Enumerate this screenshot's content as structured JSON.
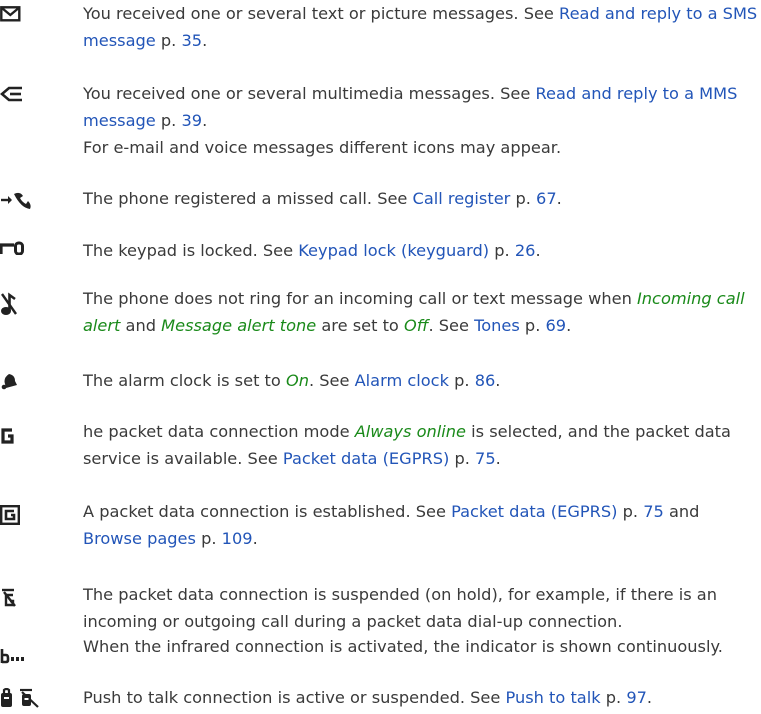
{
  "colors": {
    "text": "#3a3a3a",
    "link": "#2255b8",
    "emphasis": "#1a8a1a"
  },
  "entries": [
    {
      "icon": "envelope-icon",
      "parts": [
        {
          "t": "You received one or several text or picture messages. See "
        },
        {
          "link": "Read and reply to a SMS message"
        },
        {
          "t": " p. "
        },
        {
          "link": "35"
        },
        {
          "t": "."
        }
      ]
    },
    {
      "icon": "mms-message-icon",
      "parts": [
        {
          "t": "You received one or several multimedia messages. See "
        },
        {
          "link": "Read and reply to a MMS message"
        },
        {
          "t": " p. "
        },
        {
          "link": "39"
        },
        {
          "t": "."
        }
      ],
      "extra": "For e-mail and voice messages different icons may appear."
    },
    {
      "icon": "missed-call-icon",
      "parts": [
        {
          "t": "The phone registered a missed call. See "
        },
        {
          "link": "Call register"
        },
        {
          "t": " p. "
        },
        {
          "link": "67"
        },
        {
          "t": "."
        }
      ]
    },
    {
      "icon": "keypad-lock-icon",
      "parts": [
        {
          "t": "The keypad is locked. See "
        },
        {
          "link": "Keypad lock (keyguard)"
        },
        {
          "t": " p. "
        },
        {
          "link": "26"
        },
        {
          "t": "."
        }
      ]
    },
    {
      "icon": "silent-mode-icon",
      "parts": [
        {
          "t": "The phone does not ring for an incoming call or text message when "
        },
        {
          "em": "Incoming call alert"
        },
        {
          "t": " and "
        },
        {
          "em": "Message alert tone"
        },
        {
          "t": " are set to "
        },
        {
          "em": "Off"
        },
        {
          "t": ". See "
        },
        {
          "link": "Tones"
        },
        {
          "t": " p. "
        },
        {
          "link": "69"
        },
        {
          "t": "."
        }
      ]
    },
    {
      "icon": "alarm-bell-icon",
      "parts": [
        {
          "t": "The alarm clock is set to "
        },
        {
          "em": "On"
        },
        {
          "t": ". See "
        },
        {
          "link": "Alarm clock"
        },
        {
          "t": " p. "
        },
        {
          "link": "86"
        },
        {
          "t": "."
        }
      ]
    },
    {
      "icon": "packet-data-available-icon",
      "parts": [
        {
          "t": "he packet data connection mode "
        },
        {
          "em": "Always online"
        },
        {
          "t": " is selected, and the packet data service is available. See "
        },
        {
          "link": "Packet data (EGPRS)"
        },
        {
          "t": " p. "
        },
        {
          "link": "75"
        },
        {
          "t": "."
        }
      ]
    },
    {
      "icon": "packet-data-connected-icon",
      "parts": [
        {
          "t": "A packet data connection is established. See "
        },
        {
          "link": "Packet data (EGPRS)"
        },
        {
          "t": " p. "
        },
        {
          "link": "75"
        },
        {
          "t": " and "
        },
        {
          "link": "Browse pages"
        },
        {
          "t": " p. "
        },
        {
          "link": "109"
        },
        {
          "t": "."
        }
      ]
    },
    {
      "icon": "packet-data-suspended-icon",
      "parts": [
        {
          "t": "The packet data connection is suspended (on hold), for example, if there is an incoming or outgoing call during a packet data dial-up connection."
        }
      ]
    },
    {
      "icon": "infrared-icon",
      "parts": [
        {
          "t": "When the infrared connection is activated, the indicator is shown continuously."
        }
      ]
    },
    {
      "icon": "push-to-talk-icons",
      "parts": [
        {
          "t": "Push to talk connection is active or suspended. See "
        },
        {
          "link": "Push to talk"
        },
        {
          "t": " p. "
        },
        {
          "link": "97"
        },
        {
          "t": "."
        }
      ]
    }
  ]
}
